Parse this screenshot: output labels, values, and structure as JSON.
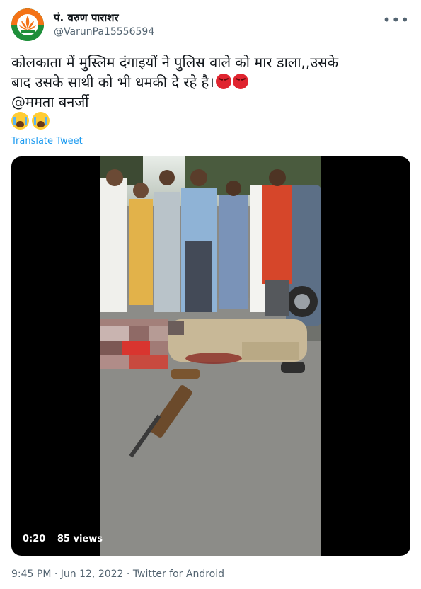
{
  "author": {
    "display_name": "पं. वरुण पाराशर",
    "handle": "@VarunPa15556594",
    "avatar_icon": "bjp-lotus-logo"
  },
  "more_icon": "more-options-icon",
  "tweet": {
    "line1": "कोलकाता में मुस्लिम दंगाइयों ने पुलिस वाले को मार डाला,,उसके",
    "line2": "बाद उसके साथी को भी धमकी दे रहे है।",
    "mention": "@ममता बनर्जी",
    "emoji_line2": [
      "angry-face-icon",
      "angry-face-icon"
    ],
    "emoji_line4": [
      "crying-face-icon",
      "crying-face-icon"
    ]
  },
  "translate_label": "Translate Tweet",
  "video": {
    "duration": "0:20",
    "views": "85 views"
  },
  "footer": {
    "time": "9:45 PM",
    "sep1": " · ",
    "date": "Jun 12, 2022",
    "sep2": " · ",
    "source": "Twitter for Android"
  },
  "colors": {
    "link": "#1d9bf0",
    "secondary_text": "#536471",
    "primary_text": "#0f1419",
    "media_bg": "#000000"
  }
}
